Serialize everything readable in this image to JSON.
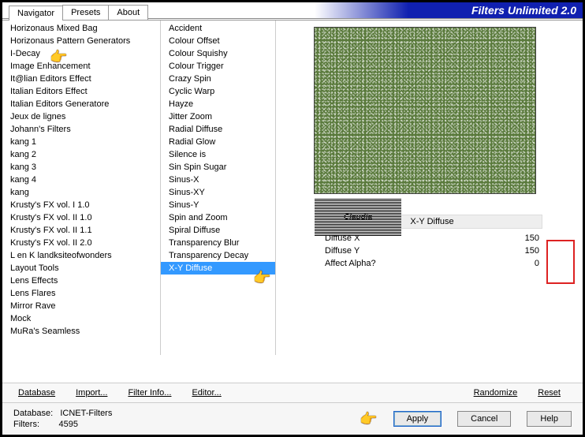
{
  "app_title": "Filters Unlimited 2.0",
  "tabs": {
    "navigator": "Navigator",
    "presets": "Presets",
    "about": "About"
  },
  "categories": [
    "Horizonaus Mixed Bag",
    "Horizonaus Pattern Generators",
    "I-Decay",
    "Image Enhancement",
    "It@lian Editors Effect",
    "Italian Editors Effect",
    "Italian Editors Generatore",
    "Jeux de lignes",
    "Johann's Filters",
    "kang 1",
    "kang 2",
    "kang 3",
    "kang 4",
    "kang",
    "Krusty's FX vol. I 1.0",
    "Krusty's FX vol. II 1.0",
    "Krusty's FX vol. II 1.1",
    "Krusty's FX vol. II 2.0",
    "L en K landksiteofwonders",
    "Layout Tools",
    "Lens Effects",
    "Lens Flares",
    "Mirror Rave",
    "Mock",
    "MuRa's Seamless"
  ],
  "filters": [
    "Accident",
    "Colour Offset",
    "Colour Squishy",
    "Colour Trigger",
    "Crazy Spin",
    "Cyclic Warp",
    "Hayze",
    "Jitter Zoom",
    "Radial Diffuse",
    "Radial Glow",
    "Silence is",
    "Sin Spin Sugar",
    "Sinus-X",
    "Sinus-XY",
    "Sinus-Y",
    "Spin and Zoom",
    "Spiral Diffuse",
    "Transparency Blur",
    "Transparency Decay",
    "X-Y Diffuse"
  ],
  "selected_filter_index": 19,
  "badge_text": "Claudia",
  "params": {
    "title": "X-Y Diffuse",
    "rows": [
      {
        "label": "Diffuse X",
        "value": "150"
      },
      {
        "label": "Diffuse Y",
        "value": "150"
      },
      {
        "label": "Affect Alpha?",
        "value": "0"
      }
    ]
  },
  "links": {
    "database": "Database",
    "import": "Import...",
    "filter_info": "Filter Info...",
    "editor": "Editor...",
    "randomize": "Randomize",
    "reset": "Reset"
  },
  "meta": {
    "db_label": "Database:",
    "db_value": "ICNET-Filters",
    "filters_label": "Filters:",
    "filters_value": "4595"
  },
  "buttons": {
    "apply": "Apply",
    "cancel": "Cancel",
    "help": "Help"
  }
}
